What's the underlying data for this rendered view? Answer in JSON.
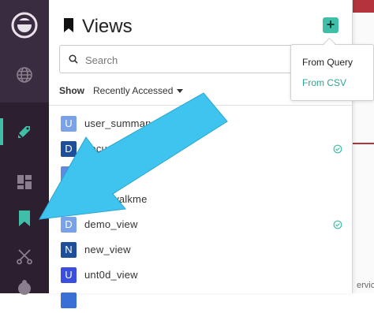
{
  "panel": {
    "title": "Views",
    "add_button_label": "+"
  },
  "search": {
    "placeholder": "Search"
  },
  "filter": {
    "show_label": "Show",
    "sort_value": "Recently Accessed"
  },
  "add_menu": {
    "options": [
      "From Query",
      "From CSV"
    ]
  },
  "views": [
    {
      "initial": "U",
      "name": "user_summary",
      "color": "#7aa2e8",
      "checked": false
    },
    {
      "initial": "D",
      "name": "documents",
      "color": "#1f4f9a",
      "checked": true
    },
    {
      "initial": "",
      "name": "...houston",
      "color": "#5d8be0",
      "checked": false
    },
    {
      "initial": "",
      "name": "view_walkme",
      "color": "#3a6fd6",
      "checked": false
    },
    {
      "initial": "D",
      "name": "demo_view",
      "color": "#7aa2e8",
      "checked": true
    },
    {
      "initial": "N",
      "name": "new_view",
      "color": "#1f4f9a",
      "checked": false
    },
    {
      "initial": "U",
      "name": "unt0d_view",
      "color": "#3a4fe0",
      "checked": false
    }
  ],
  "background_text": "ervic",
  "colors": {
    "accent": "#3fbfa8",
    "rail": "#2c1f30",
    "pointer_arrow": "#3ec4ef"
  },
  "icons": [
    "logo-icon",
    "globe-icon",
    "pencil-tag-icon",
    "dashboard-icon",
    "bookmark-icon",
    "scissors-icon",
    "search-icon",
    "check-circle-icon"
  ]
}
